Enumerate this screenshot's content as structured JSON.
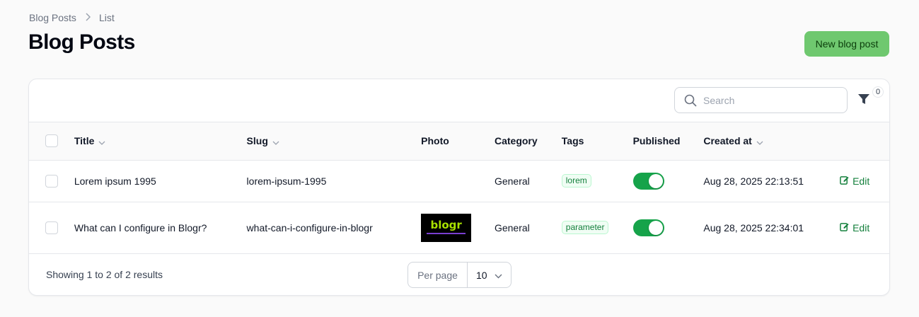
{
  "breadcrumb": {
    "parent": "Blog Posts",
    "current": "List"
  },
  "page": {
    "title": "Blog Posts",
    "new_button": "New blog post"
  },
  "search": {
    "placeholder": "Search"
  },
  "filter": {
    "active_count": "0"
  },
  "columns": {
    "title": "Title",
    "slug": "Slug",
    "photo": "Photo",
    "category": "Category",
    "tags": "Tags",
    "published": "Published",
    "created_at": "Created at"
  },
  "rows": [
    {
      "title": "Lorem ipsum 1995",
      "slug": "lorem-ipsum-1995",
      "category": "General",
      "tag": "lorem",
      "published": true,
      "created_at": "Aug 28, 2025 22:13:51",
      "action": "Edit"
    },
    {
      "title": "What can I configure in Blogr?",
      "slug": "what-can-i-configure-in-blogr",
      "photo_logo": "blogr",
      "category": "General",
      "tag": "parameter",
      "published": true,
      "created_at": "Aug 28, 2025 22:34:01",
      "action": "Edit"
    }
  ],
  "footer": {
    "summary": "Showing 1 to 2 of 2 results",
    "per_page_label": "Per page",
    "per_page_value": "10"
  },
  "colors": {
    "accent": "#16a34a",
    "button_bg": "#6fc86f",
    "tag_text": "#15803d"
  }
}
